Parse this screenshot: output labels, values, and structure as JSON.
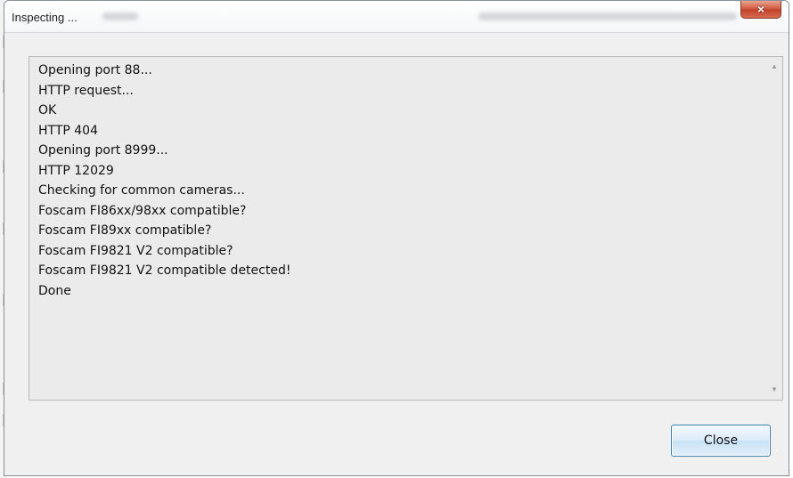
{
  "dialog": {
    "title": "Inspecting ...",
    "close_icon": "×",
    "close_button_label": "Close"
  },
  "log": {
    "lines": [
      "Opening port 88...",
      "HTTP request...",
      "OK",
      "HTTP 404",
      "Opening port 8999...",
      "HTTP 12029",
      "Checking for common cameras...",
      "Foscam FI86xx/98xx compatible?",
      "Foscam FI89xx compatible?",
      "Foscam FI9821 V2 compatible?",
      "Foscam FI9821 V2 compatible detected!",
      "Done"
    ]
  },
  "scrollbar": {
    "up_arrow": "▲",
    "down_arrow": "▼"
  },
  "colors": {
    "dialog_bg": "#f0f0f0",
    "log_bg": "#ebebeb",
    "close_x_red": "#c0402a",
    "button_border": "#3c7fb1"
  }
}
